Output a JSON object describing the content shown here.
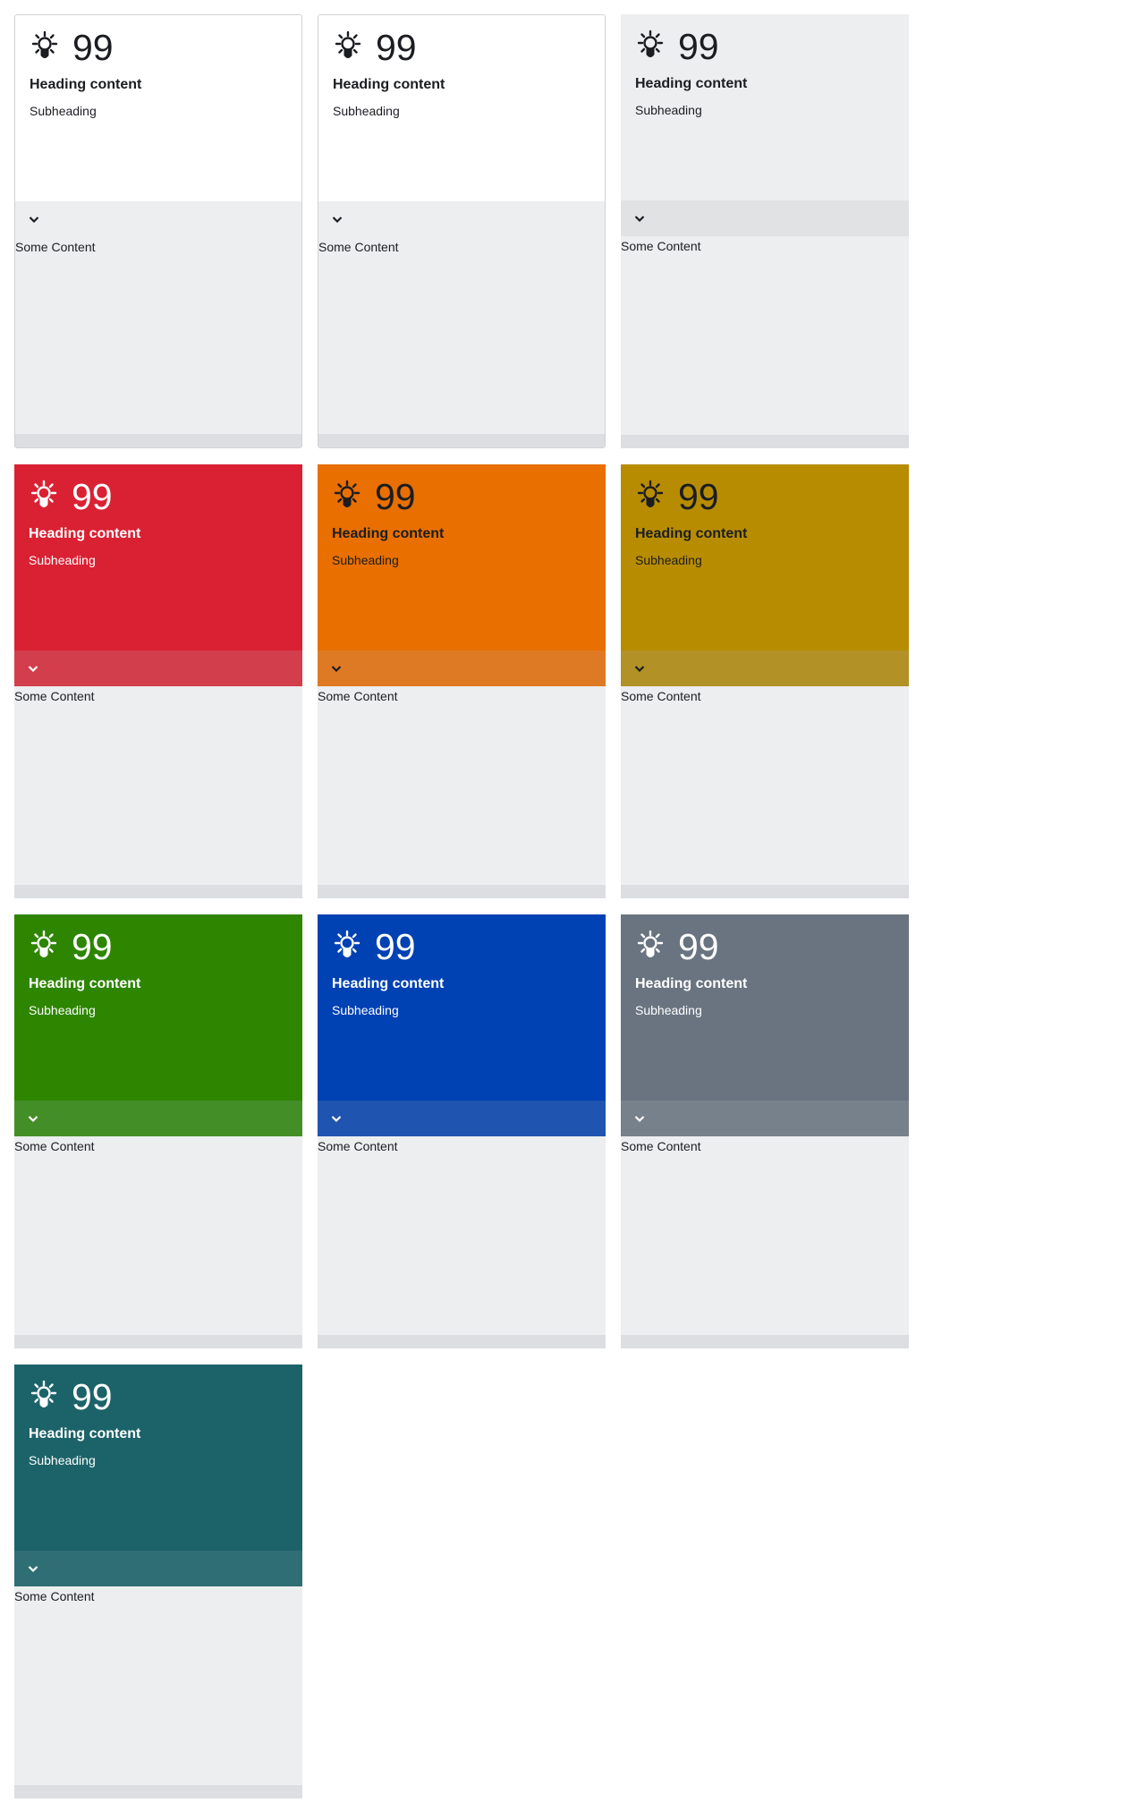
{
  "cards": [
    {
      "variant": "white",
      "icon": "lightbulb-icon",
      "count": "99",
      "heading": "Heading content",
      "subheading": "Subheading",
      "content": "Some Content"
    },
    {
      "variant": "white",
      "icon": "lightbulb-icon",
      "count": "99",
      "heading": "Heading content",
      "subheading": "Subheading",
      "content": "Some Content"
    },
    {
      "variant": "neutral",
      "icon": "lightbulb-icon",
      "count": "99",
      "heading": "Heading content",
      "subheading": "Subheading",
      "content": "Some Content"
    },
    {
      "variant": "red",
      "color": "#da2133",
      "icon": "lightbulb-icon",
      "count": "99",
      "heading": "Heading content",
      "subheading": "Subheading",
      "content": "Some Content"
    },
    {
      "variant": "orange",
      "color": "#e86f00",
      "icon": "lightbulb-icon",
      "count": "99",
      "heading": "Heading content",
      "subheading": "Subheading",
      "content": "Some Content"
    },
    {
      "variant": "yellow",
      "color": "#b88c00",
      "icon": "lightbulb-icon",
      "count": "99",
      "heading": "Heading content",
      "subheading": "Subheading",
      "content": "Some Content"
    },
    {
      "variant": "green",
      "color": "#2d8500",
      "icon": "lightbulb-icon",
      "count": "99",
      "heading": "Heading content",
      "subheading": "Subheading",
      "content": "Some Content"
    },
    {
      "variant": "blue",
      "color": "#0041b3",
      "icon": "lightbulb-icon",
      "count": "99",
      "heading": "Heading content",
      "subheading": "Subheading",
      "content": "Some Content"
    },
    {
      "variant": "gray",
      "color": "#697480",
      "icon": "lightbulb-icon",
      "count": "99",
      "heading": "Heading content",
      "subheading": "Subheading",
      "content": "Some Content"
    },
    {
      "variant": "teal",
      "color": "#1c6369",
      "icon": "lightbulb-icon",
      "count": "99",
      "heading": "Heading content",
      "subheading": "Subheading",
      "content": "Some Content"
    }
  ],
  "toggle_icon": "chevron-down-icon"
}
